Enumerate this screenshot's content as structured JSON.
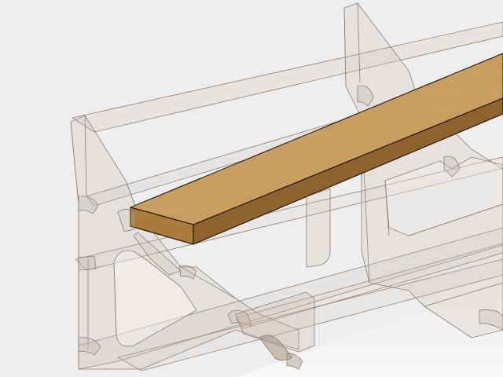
{
  "viewport": {
    "background": "#eeeeee",
    "floor_color": "#f7f7f7"
  },
  "rack": {
    "part": "translucent-support-rack",
    "material": "transparent-acrylic",
    "fill_color": "#c8b9ad",
    "edge_color": "#8e7f74"
  },
  "board": {
    "part": "wooden-plank",
    "material": "oak-wood",
    "top_color": "#c99d5e",
    "side_color": "#8d642f",
    "end_color": "#a8793b",
    "edge_color": "#2a1a0c"
  }
}
